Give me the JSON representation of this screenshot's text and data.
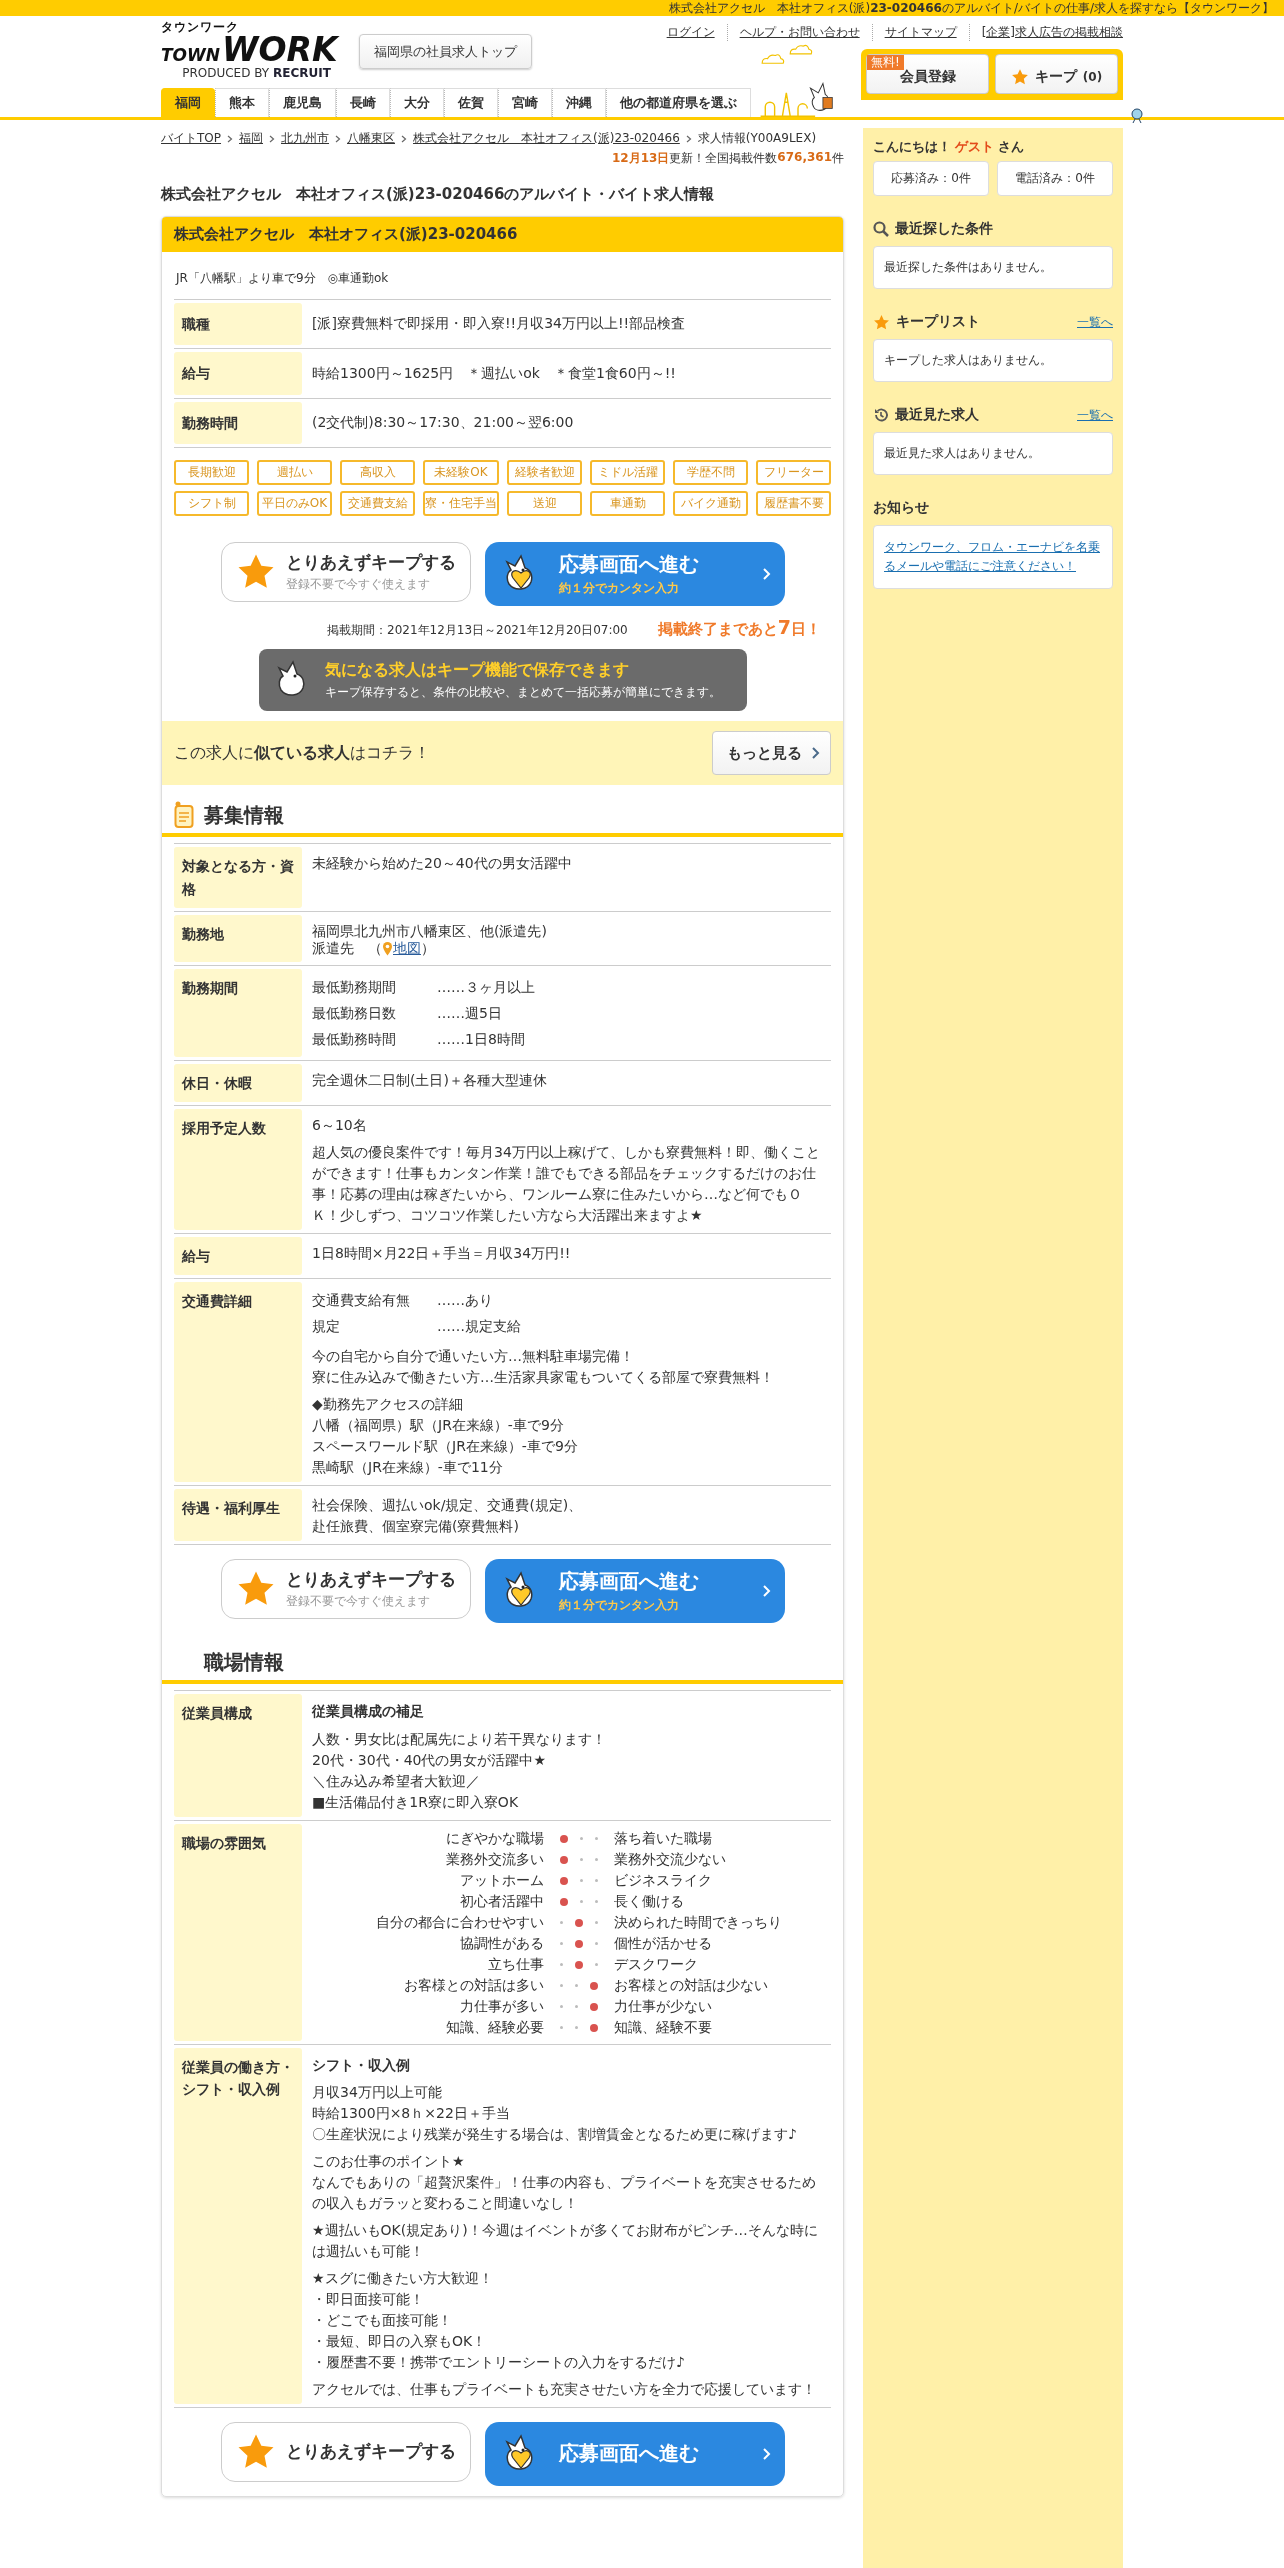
{
  "top_strip": "株式会社アクセル　本社オフィス(派)**23-020466**のアルバイト/バイトの仕事/求人を探すなら【タウンワーク】",
  "logo": {
    "kana": "タウンワーク",
    "town": "TOWN",
    "work": "WORK",
    "by": "PRODUCED BY",
    "brand": "RECRUIT"
  },
  "top_button": "福岡県の社員求人トップ",
  "header_links": [
    "ログイン",
    "ヘルプ・お問い合わせ",
    "サイトマップ",
    "[企業]求人広告の掲載相談"
  ],
  "member_button": {
    "badge": "無料!",
    "label": "会員登録"
  },
  "keep_button": {
    "label": "キープ",
    "count": "(0)"
  },
  "prefecture_tabs": [
    {
      "label": "福岡",
      "selected": true
    },
    {
      "label": "熊本",
      "selected": false
    },
    {
      "label": "鹿児島",
      "selected": false
    },
    {
      "label": "長崎",
      "selected": false
    },
    {
      "label": "大分",
      "selected": false
    },
    {
      "label": "佐賀",
      "selected": false
    },
    {
      "label": "宮崎",
      "selected": false
    },
    {
      "label": "沖縄",
      "selected": false
    },
    {
      "label": "他の都道府県を選ぶ",
      "selected": false
    }
  ],
  "breadcrumbs": {
    "links": [
      "バイトTOP",
      "福岡",
      "北九州市",
      "八幡東区",
      "株式会社アクセル　本社オフィス(派)23-020466"
    ],
    "current": "求人情報(Y00A9LEX)"
  },
  "update": {
    "date": "12月13日",
    "text": "更新！全国掲載件数",
    "count": "676,361",
    "unit": "件"
  },
  "page_title": "株式会社アクセル　本社オフィス(派)23-020466のアルバイト・バイト求人情報",
  "job": {
    "name": "株式会社アクセル　本社オフィス(派)23-020466",
    "access": "JR「八幡駅」より車で9分　◎車通勤ok",
    "summary": [
      {
        "label": "職種",
        "value": "[派]寮費無料で即採用・即入寮!!月収34万円以上!!部品検査"
      },
      {
        "label": "給与",
        "value": "時給1300円～1625円　＊週払いok　＊食堂1食60円～!!"
      },
      {
        "label": "勤務時間",
        "value": "(2交代制)8:30～17:30、21:00～翌6:00"
      }
    ],
    "tags": [
      "長期歓迎",
      "週払い",
      "高収入",
      "未経験OK",
      "経験者歓迎",
      "ミドル活躍",
      "学歴不問",
      "フリーター",
      "シフト制",
      "平日のみOK",
      "交通費支給",
      "寮・住宅手当",
      "送迎",
      "車通勤",
      "バイク通勤",
      "履歴書不要"
    ],
    "actions": {
      "keep_title": "とりあえずキープする",
      "keep_sub": "登録不要で今すぐ使えます",
      "apply_title": "応募画面へ進む",
      "apply_sub": "約１分でカンタン入力"
    },
    "period": "掲載期間：2021年12月13日～2021年12月20日07:00",
    "remaining": {
      "before": "掲載終了まであと",
      "days": "7",
      "after": "日！"
    },
    "keep_banner": {
      "title": "気になる求人はキープ機能で保存できます",
      "text": "キープ保存すると、条件の比較や、まとめて一括応募が簡単にできます。"
    },
    "similar": {
      "text": "この求人に**似ている求人**はコチラ！",
      "button": "もっと見る"
    }
  },
  "sections": [
    {
      "kind": "recruit",
      "title": "募集情報",
      "rows": [
        {
          "label": "対象となる方・資格",
          "blocks": [
            {
              "kind": "text",
              "lines": [
                "未経験から始めた20～40代の男女活躍中"
              ]
            }
          ]
        },
        {
          "label": "勤務地",
          "blocks": [
            {
              "kind": "text",
              "lines": [
                "福岡県北九州市八幡東区、他(派遣先)"
              ]
            },
            {
              "kind": "place",
              "prefix": "派遣先　（",
              "link": "地図",
              "suffix": "）"
            }
          ]
        },
        {
          "label": "勤務期間",
          "blocks": [
            {
              "kind": "pairs",
              "items": [
                {
                  "key": "最低勤務期間",
                  "value": "……３ヶ月以上"
                },
                {
                  "key": "最低勤務日数",
                  "value": "……週5日"
                },
                {
                  "key": "最低勤務時間",
                  "value": "……1日8時間"
                }
              ]
            }
          ]
        },
        {
          "label": "休日・休暇",
          "blocks": [
            {
              "kind": "text",
              "lines": [
                "完全週休二日制(土日)＋各種大型連休"
              ]
            }
          ]
        },
        {
          "label": "採用予定人数",
          "blocks": [
            {
              "kind": "text",
              "lines": [
                "6～10名"
              ]
            },
            {
              "kind": "text",
              "lines": [
                "超人気の優良案件です！毎月34万円以上稼げて、しかも寮費無料！即、働くことができます！仕事もカンタン作業！誰でもできる部品をチェックするだけのお仕事！応募の理由は稼ぎたいから、ワンルーム寮に住みたいから…など何でもＯＫ！少しずつ、コツコツ作業したい方なら大活躍出来ますよ★"
              ]
            }
          ]
        },
        {
          "label": "給与",
          "blocks": [
            {
              "kind": "text",
              "lines": [
                "1日8時間×月22日＋手当＝月収34万円!!"
              ]
            }
          ]
        },
        {
          "label": "交通費詳細",
          "blocks": [
            {
              "kind": "pairs",
              "items": [
                {
                  "key": "交通費支給有無",
                  "value": "……あり"
                },
                {
                  "key": "規定",
                  "value": "……規定支給"
                }
              ]
            },
            {
              "kind": "text",
              "lines": [
                "今の自宅から自分で通いたい方…無料駐車場完備！",
                "寮に住み込みで働きたい方…生活家具家電もついてくる部屋で寮費無料！"
              ]
            },
            {
              "kind": "text",
              "lines": [
                "◆勤務先アクセスの詳細",
                "八幡（福岡県）駅（JR在来線）-車で9分",
                "スペースワールド駅（JR在来線）-車で9分",
                "黒崎駅（JR在来線）-車で11分"
              ]
            }
          ]
        },
        {
          "label": "待遇・福利厚生",
          "blocks": [
            {
              "kind": "text",
              "lines": [
                "社会保険、週払いok/規定、交通費(規定)、",
                "赴任旅費、個室寮完備(寮費無料)"
              ]
            }
          ]
        }
      ],
      "actions": {
        "keep_title": "とりあえずキープする",
        "keep_sub": "登録不要で今すぐ使えます",
        "apply_title": "応募画面へ進む",
        "apply_sub": "約１分でカンタン入力"
      }
    },
    {
      "kind": "workplace",
      "title": "職場情報",
      "rows": [
        {
          "label": "従業員構成",
          "blocks": [
            {
              "kind": "heading",
              "text": "従業員構成の補足"
            },
            {
              "kind": "text",
              "lines": [
                "人数・男女比は配属先により若干異なります！",
                "20代・30代・40代の男女が活躍中★",
                "＼住み込み希望者大歓迎／",
                "■生活備品付き1R寮に即入寮OK"
              ]
            }
          ]
        },
        {
          "label": "職場の雰囲気",
          "blocks": [
            {
              "kind": "scale",
              "items": [
                {
                  "left": "にぎやかな職場",
                  "right": "落ち着いた職場",
                  "dots": [
                    {
                      "selected": true
                    },
                    {
                      "selected": false
                    },
                    {
                      "selected": false
                    }
                  ]
                },
                {
                  "left": "業務外交流多い",
                  "right": "業務外交流少ない",
                  "dots": [
                    {
                      "selected": true
                    },
                    {
                      "selected": false
                    },
                    {
                      "selected": false
                    }
                  ]
                },
                {
                  "left": "アットホーム",
                  "right": "ビジネスライク",
                  "dots": [
                    {
                      "selected": true
                    },
                    {
                      "selected": false
                    },
                    {
                      "selected": false
                    }
                  ]
                },
                {
                  "left": "初心者活躍中",
                  "right": "長く働ける",
                  "dots": [
                    {
                      "selected": true
                    },
                    {
                      "selected": false
                    },
                    {
                      "selected": false
                    }
                  ]
                },
                {
                  "left": "自分の都合に合わせやすい",
                  "right": "決められた時間できっちり",
                  "dots": [
                    {
                      "selected": false
                    },
                    {
                      "selected": true
                    },
                    {
                      "selected": false
                    }
                  ]
                },
                {
                  "left": "協調性がある",
                  "right": "個性が活かせる",
                  "dots": [
                    {
                      "selected": false
                    },
                    {
                      "selected": true
                    },
                    {
                      "selected": false
                    }
                  ]
                },
                {
                  "left": "立ち仕事",
                  "right": "デスクワーク",
                  "dots": [
                    {
                      "selected": false
                    },
                    {
                      "selected": true
                    },
                    {
                      "selected": false
                    }
                  ]
                },
                {
                  "left": "お客様との対話は多い",
                  "right": "お客様との対話は少ない",
                  "dots": [
                    {
                      "selected": false
                    },
                    {
                      "selected": false
                    },
                    {
                      "selected": true
                    }
                  ]
                },
                {
                  "left": "力仕事が多い",
                  "right": "力仕事が少ない",
                  "dots": [
                    {
                      "selected": false
                    },
                    {
                      "selected": false
                    },
                    {
                      "selected": true
                    }
                  ]
                },
                {
                  "left": "知識、経験必要",
                  "right": "知識、経験不要",
                  "dots": [
                    {
                      "selected": false
                    },
                    {
                      "selected": false
                    },
                    {
                      "selected": true
                    }
                  ]
                }
              ]
            }
          ]
        },
        {
          "label": "従業員の働き方・シフト・収入例",
          "blocks": [
            {
              "kind": "heading",
              "text": "シフト・収入例"
            },
            {
              "kind": "text",
              "lines": [
                "月収34万円以上可能",
                "時給1300円×8ｈ×22日＋手当",
                "〇生産状況により残業が発生する場合は、割増賃金となるため更に稼げます♪"
              ]
            },
            {
              "kind": "text",
              "lines": [
                "このお仕事のポイント★",
                "なんでもありの「超贅沢案件」！仕事の内容も、プライベートを充実させるための収入もガラッと変わること間違いなし！"
              ]
            },
            {
              "kind": "text",
              "lines": [
                "★週払いもOK(規定あり)！今週はイベントが多くてお財布がピンチ…そんな時には週払いも可能！"
              ]
            },
            {
              "kind": "text",
              "lines": [
                "★スグに働きたい方大歓迎！",
                "・即日面接可能！",
                "・どこでも面接可能！",
                "・最短、即日の入寮もOK！",
                "・履歴書不要！携帯でエントリーシートの入力をするだけ♪"
              ]
            },
            {
              "kind": "text",
              "lines": [
                "アクセルでは、仕事もプライベートも充実させたい方を全力で応援しています！"
              ]
            }
          ]
        }
      ]
    }
  ],
  "bottom_actions": {
    "keep_title": "とりあえずキープする",
    "apply_title": "応募画面へ進む"
  },
  "sidebar": {
    "greeting": {
      "before": "こんにちは！",
      "name": "ゲスト",
      "after": "さん"
    },
    "counters": [
      "応募済み：0件",
      "電話済み：0件"
    ],
    "panels": [
      {
        "kind": "search",
        "title": "最近探した条件",
        "body": "最近探した条件はありません。"
      },
      {
        "kind": "star",
        "title": "キープリスト",
        "link": "一覧へ",
        "body": "キープした求人はありません。"
      },
      {
        "kind": "history",
        "title": "最近見た求人",
        "link": "一覧へ",
        "body": "最近見た求人はありません。"
      }
    ],
    "notice": {
      "title": "お知らせ",
      "link": "タウンワーク、フロム・エーナビを名乗るメールや電話にご注意ください！"
    }
  }
}
